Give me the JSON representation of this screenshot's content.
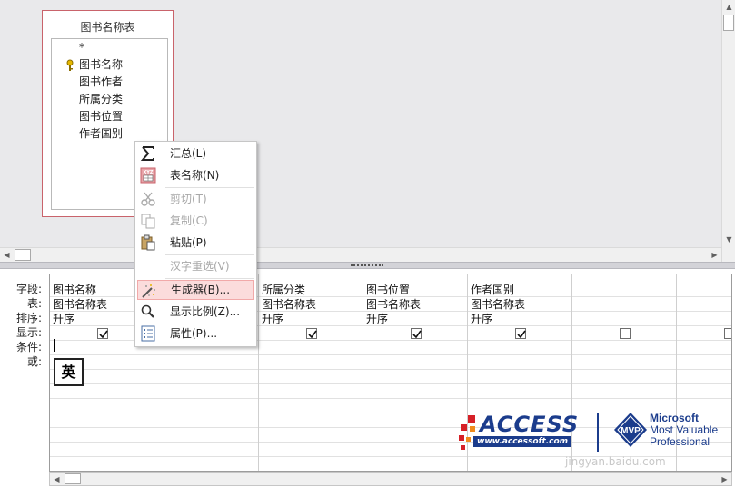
{
  "table_box": {
    "title": "图书名称表",
    "fields": [
      "*",
      "图书名称",
      "图书作者",
      "所属分类",
      "图书位置",
      "作者国别"
    ],
    "primary_key_icon": "key-icon"
  },
  "grid": {
    "row_labels": [
      "字段:",
      "表:",
      "排序:",
      "显示:",
      "条件:",
      "或:"
    ],
    "columns": [
      {
        "field": "图书名称",
        "table": "图书名称表",
        "sort": "升序",
        "show": true
      },
      {
        "field": "",
        "table": "",
        "sort": "",
        "show": null
      },
      {
        "field": "所属分类",
        "table": "图书名称表",
        "sort": "升序",
        "show": true
      },
      {
        "field": "图书位置",
        "table": "图书名称表",
        "sort": "升序",
        "show": true
      },
      {
        "field": "作者国别",
        "table": "图书名称表",
        "sort": "升序",
        "show": true
      },
      {
        "field": "",
        "table": "",
        "sort": "",
        "show": false
      },
      {
        "field": "",
        "table": "",
        "sort": "",
        "show": false
      }
    ],
    "ime_indicator": "英"
  },
  "context_menu": {
    "items": [
      {
        "label": "汇总(L)",
        "icon": "sigma-icon",
        "disabled": false
      },
      {
        "label": "表名称(N)",
        "icon": "table-names-icon",
        "disabled": false
      },
      {
        "label": "剪切(T)",
        "icon": "scissors-icon",
        "disabled": true
      },
      {
        "label": "复制(C)",
        "icon": "copy-icon",
        "disabled": true
      },
      {
        "label": "粘贴(P)",
        "icon": "paste-icon",
        "disabled": false
      },
      {
        "label": "汉字重选(V)",
        "icon": "",
        "disabled": true
      },
      {
        "label": "生成器(B)...",
        "icon": "builder-wand-icon",
        "disabled": false,
        "highlighted": true
      },
      {
        "label": "显示比例(Z)...",
        "icon": "zoom-magnifier-icon",
        "disabled": false
      },
      {
        "label": "属性(P)...",
        "icon": "properties-sheet-icon",
        "disabled": false
      }
    ]
  },
  "logo": {
    "brand": "ACCESS",
    "url": "www.accessoft.com",
    "mvp_badge": "MVP",
    "mvp_line1": "Microsoft",
    "mvp_line2": "Most Valuable",
    "mvp_line3": "Professional",
    "watermark": "jingyan.baidu.com"
  },
  "colors": {
    "table_border": "#c9636b",
    "menu_highlight": "#fbdcdc",
    "brand_blue": "#1b3c8c",
    "brand_red": "#d62027"
  }
}
